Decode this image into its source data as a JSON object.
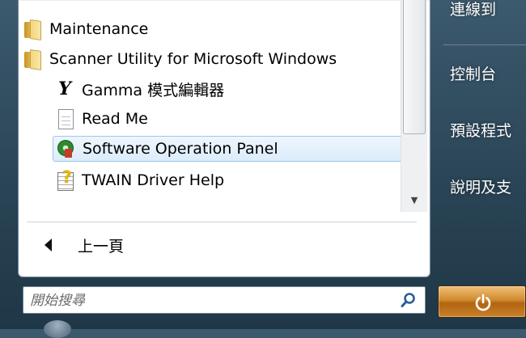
{
  "program_list": {
    "items": [
      {
        "label": "Maintenance",
        "icon": "folder-icon"
      },
      {
        "label": "Scanner Utility for Microsoft Windows",
        "icon": "folder-icon"
      },
      {
        "label": "Gamma 模式編輯器",
        "icon": "gamma-icon",
        "icon_glyph": "Y"
      },
      {
        "label": "Read Me",
        "icon": "document-icon"
      },
      {
        "label": "Software Operation Panel",
        "icon": "gear-icon",
        "selected": true
      },
      {
        "label": "TWAIN Driver Help",
        "icon": "help-icon"
      }
    ]
  },
  "back": {
    "label": "上一頁"
  },
  "search": {
    "placeholder": "開始搜尋"
  },
  "right_pane": {
    "items": [
      {
        "label": "連線到"
      },
      {
        "label": "控制台"
      },
      {
        "label": "預設程式"
      },
      {
        "label": "說明及支"
      }
    ]
  },
  "colors": {
    "selection_bg": "#dcecfb",
    "selection_border": "#9dc6ee",
    "power_button": "#d08a2e",
    "right_pane_text": "#ffffff"
  }
}
